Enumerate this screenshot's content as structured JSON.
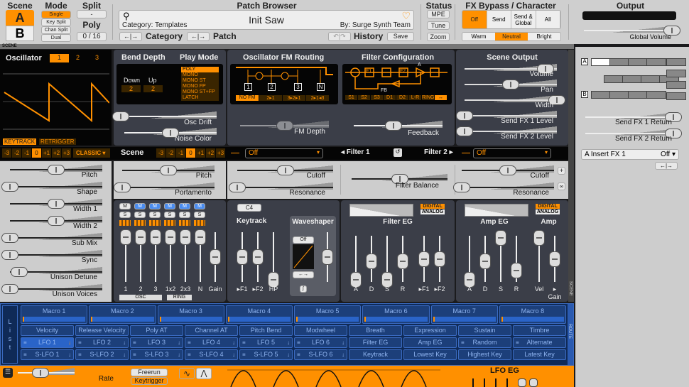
{
  "header": {
    "scene_label": "Scene",
    "scene_a": "A",
    "scene_b": "B",
    "mode_label": "Mode",
    "modes": [
      "Single",
      "Key Split",
      "Chan Split",
      "Dual"
    ],
    "split_label": "Split",
    "split_value": "-",
    "poly_label": "Poly",
    "poly_value": "0 / 16",
    "patch_browser_label": "Patch Browser",
    "patch_name": "Init Saw",
    "category": "Category: Templates",
    "author": "By: Surge Synth Team",
    "category_nav": "Category",
    "patch_nav": "Patch",
    "history": "History",
    "save": "Save",
    "status_label": "Status",
    "status_buttons": [
      "MPE",
      "Tune",
      "Zoom"
    ],
    "fx_label": "FX Bypass / Character",
    "fx_buttons": [
      "Off",
      "Send",
      "Send & Global",
      "All"
    ],
    "character": [
      "Warm",
      "Neutral",
      "Bright"
    ],
    "output_label": "Output",
    "global_volume": "Global Volume",
    "global_volume_value": 0.95
  },
  "scene_strip": "SCENE",
  "osc": {
    "title": "Oscillator",
    "tabs": [
      "1",
      "2",
      "3"
    ],
    "keytrack": "KEYTRACK",
    "retrigger": "RETRIGGER",
    "steps": [
      "-3",
      "-2",
      "-1",
      "0",
      "+1",
      "+2",
      "+3"
    ],
    "type": "CLASSIC",
    "params": [
      {
        "label": "Pitch",
        "value": 0.5
      },
      {
        "label": "Shape",
        "value": 0.0
      },
      {
        "label": "Width 1",
        "value": 0.5
      },
      {
        "label": "Width 2",
        "value": 0.5
      },
      {
        "label": "Sub Mix",
        "value": 0.0
      },
      {
        "label": "Sync",
        "value": 0.0
      },
      {
        "label": "Unison Detune",
        "value": 0.1
      },
      {
        "label": "Unison Voices",
        "value": 0.0
      }
    ]
  },
  "bend": {
    "title": "Bend Depth",
    "down_label": "Down",
    "up_label": "Up",
    "down": "2",
    "up": "2"
  },
  "play_mode": {
    "title": "Play Mode",
    "options": [
      "POLY",
      "MONO",
      "MONO ST",
      "MONO FP",
      "MONO ST+FP",
      "LATCH"
    ]
  },
  "osc_drift": {
    "label": "Osc Drift",
    "value": 0.0
  },
  "noise_color": {
    "label": "Noise Color",
    "value": 0.5
  },
  "fm": {
    "title": "Oscillator FM Routing",
    "nodes": [
      "1",
      "2",
      "3",
      "N"
    ],
    "options": [
      "NO FM",
      "2▸1",
      "3▸2▸1",
      "2▸1◂3"
    ],
    "depth_label": "FM Depth",
    "depth_value": 0.5
  },
  "filter_config": {
    "title": "Filter Configuration",
    "blocks": [
      "F1",
      "F2"
    ],
    "fb": "FB",
    "a": "A",
    "options": [
      "S1",
      "S2",
      "S3",
      "D1",
      "D2",
      "L-R",
      "RING",
      "↔"
    ],
    "feedback_label": "Feedback",
    "feedback_value": 0.45
  },
  "scene_output": {
    "title": "Scene Output",
    "params": [
      {
        "label": "Volume",
        "value": 0.88
      },
      {
        "label": "Pan",
        "value": 0.5
      },
      {
        "label": "Width",
        "value": 1.0
      },
      {
        "label": "Send FX 1 Level",
        "value": 0.0
      },
      {
        "label": "Send FX 2 Level",
        "value": 0.0
      }
    ]
  },
  "scene_row": {
    "label": "Scene",
    "steps": [
      "-3",
      "-2",
      "-1",
      "0",
      "+1",
      "+2",
      "+3"
    ],
    "pitch": {
      "label": "Pitch",
      "value": 0.5
    },
    "portamento": {
      "label": "Portamento",
      "value": 0.0
    }
  },
  "filters": {
    "f1_type": "Off",
    "f2_type": "Off",
    "filter1": "◂ Filter 1",
    "filter2": "Filter 2 ▸",
    "cutoff1": {
      "label": "Cutoff",
      "value": 0.5
    },
    "res1": {
      "label": "Resonance",
      "value": 0.0
    },
    "balance": {
      "label": "Filter Balance",
      "value": 0.5
    },
    "cutoff2": {
      "label": "Cutoff",
      "value": 0.5
    },
    "res2": {
      "label": "Resonance",
      "value": 0.0
    }
  },
  "mixer": {
    "channels": [
      {
        "label": "1",
        "value": 0.9
      },
      {
        "label": "2",
        "value": 0.9
      },
      {
        "label": "3",
        "value": 0.9
      },
      {
        "label": "1x2",
        "value": 0.9
      },
      {
        "label": "2x3",
        "value": 0.9
      },
      {
        "label": "N",
        "value": 0.9
      },
      {
        "label": "Gain",
        "value": 0.5
      }
    ],
    "osc_group": "OSC",
    "ring_group": "RING",
    "m": "M",
    "s": "S"
  },
  "keytrack": {
    "note": "C4",
    "title": "Keytrack",
    "sliders": [
      {
        "label": "▸F1",
        "value": 0.5
      },
      {
        "label": "▸F2",
        "value": 0.5
      },
      {
        "label": "HP",
        "value": 0.05
      }
    ]
  },
  "waveshaper": {
    "title": "Waveshaper",
    "type": "Off",
    "drive": 0.5
  },
  "filter_eg": {
    "title": "Filter EG",
    "digital": "DIGITAL",
    "analog": "ANALOG",
    "sliders": [
      {
        "label": "A",
        "value": 0.05
      },
      {
        "label": "D",
        "value": 0.45
      },
      {
        "label": "S",
        "value": 0.05
      },
      {
        "label": "R",
        "value": 0.45
      },
      {
        "label": "▸F1",
        "value": 0.5
      },
      {
        "label": "▸F2",
        "value": 0.5
      }
    ]
  },
  "amp_eg": {
    "title": "Amp EG",
    "amp_title": "Amp",
    "digital": "DIGITAL",
    "analog": "ANALOG",
    "sliders": [
      {
        "label": "A",
        "value": 0.05
      },
      {
        "label": "D",
        "value": 0.45
      },
      {
        "label": "S",
        "value": 0.95
      },
      {
        "label": "R",
        "value": 0.25
      },
      {
        "label": "Vel",
        "value": 0.95
      },
      {
        "label": "▸ Gain",
        "value": 0.5
      }
    ]
  },
  "fx_routing": {
    "a": "A",
    "b": "B",
    "send1": {
      "label": "Send FX 1 Return",
      "value": 0.95
    },
    "send2": {
      "label": "Send FX 2 Return",
      "value": 0.95
    },
    "insert_name": "A Insert FX 1",
    "insert_type": "Off ▾"
  },
  "side_tabs": {
    "scene": "SCENE",
    "route": "ROUTE"
  },
  "routing": {
    "list_label": "List",
    "macros": [
      "Macro 1",
      "Macro 2",
      "Macro 3",
      "Macro 4",
      "Macro 5",
      "Macro 6",
      "Macro 7",
      "Macro 8"
    ],
    "row1": [
      "Velocity",
      "Release Velocity",
      "Poly AT",
      "Channel AT",
      "Pitch Bend",
      "Modwheel",
      "Breath",
      "Expression",
      "Sustain",
      "Timbre"
    ],
    "row2": [
      "LFO 1",
      "LFO 2",
      "LFO 3",
      "LFO 4",
      "LFO 5",
      "LFO 6",
      "Filter EG",
      "Amp EG",
      "Random",
      "Alternate"
    ],
    "row3": [
      "S-LFO 1",
      "S-LFO 2",
      "S-LFO 3",
      "S-LFO 4",
      "S-LFO 5",
      "S-LFO 6",
      "Keytrack",
      "Lowest Key",
      "Highest Key",
      "Latest Key"
    ]
  },
  "lfo": {
    "rate_label": "Rate",
    "rate_value": 0.4,
    "freerun": "Freerun",
    "keytrigger": "Keytrigger",
    "eg_title": "LFO EG"
  },
  "colors": {
    "orange": "#ff9000",
    "panel": "#3b3e48",
    "route_blue": "#1c3f7a"
  }
}
